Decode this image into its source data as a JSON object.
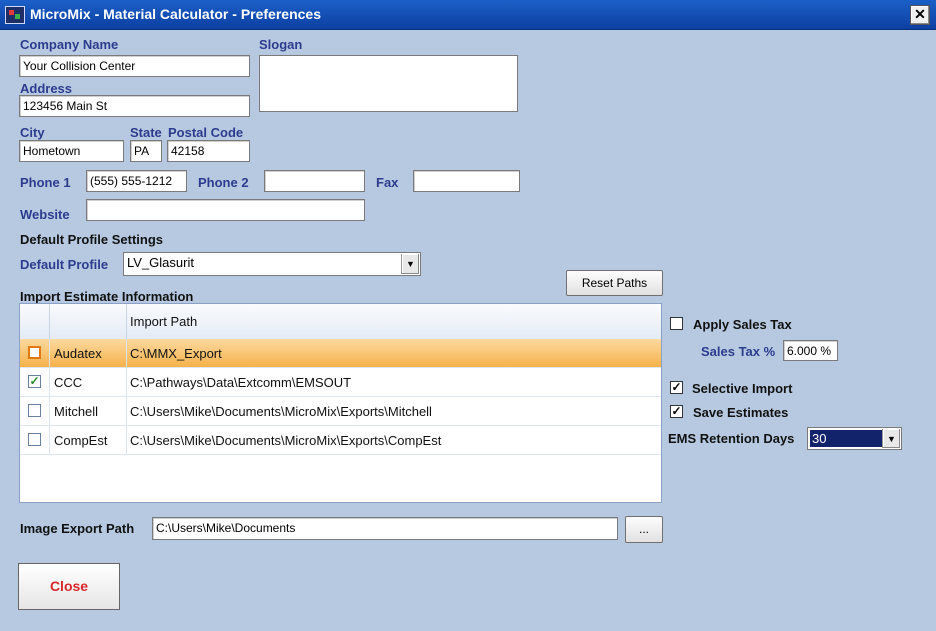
{
  "window": {
    "title": "MicroMix - Material Calculator - Preferences",
    "close_glyph": "✕"
  },
  "company": {
    "name_label": "Company Name",
    "name_value": "Your Collision Center",
    "slogan_label": "Slogan",
    "slogan_value": "",
    "address_label": "Address",
    "address_value": "123456 Main St"
  },
  "location": {
    "city_label": "City",
    "city_value": "Hometown",
    "state_label": "State",
    "state_value": "PA",
    "postal_label": "Postal Code",
    "postal_value": "42158"
  },
  "contact": {
    "phone1_label": "Phone 1",
    "phone1_value": "(555) 555-1212",
    "phone2_label": "Phone 2",
    "phone2_value": "",
    "fax_label": "Fax",
    "fax_value": "",
    "website_label": "Website",
    "website_value": ""
  },
  "profile": {
    "section_label": "Default Profile Settings",
    "default_label": "Default Profile",
    "default_value": "LV_Glasurit"
  },
  "import": {
    "section_label": "Import Estimate Information",
    "reset_label": "Reset Paths",
    "column_path": "Import Path",
    "rows": [
      {
        "name": "Audatex",
        "path": "C:\\MMX_Export",
        "checked": false,
        "check_glyph": ""
      },
      {
        "name": "CCC",
        "path": "C:\\Pathways\\Data\\Extcomm\\EMSOUT",
        "checked": true,
        "check_glyph": "✓"
      },
      {
        "name": "Mitchell",
        "path": "C:\\Users\\Mike\\Documents\\MicroMix\\Exports\\Mitchell",
        "checked": false,
        "check_glyph": ""
      },
      {
        "name": "CompEst",
        "path": "C:\\Users\\Mike\\Documents\\MicroMix\\Exports\\CompEst",
        "checked": false,
        "check_glyph": ""
      }
    ]
  },
  "options": {
    "apply_tax_label": "Apply Sales Tax",
    "apply_tax_checked": false,
    "tax_pct_label": "Sales Tax %",
    "tax_pct_value": "6.000 %",
    "selective_label": "Selective Import",
    "selective_checked": true,
    "selective_glyph": "✓",
    "save_est_label": "Save Estimates",
    "save_est_checked": true,
    "save_est_glyph": "✓",
    "retention_label": "EMS Retention Days",
    "retention_value": "30"
  },
  "export": {
    "label": "Image Export Path",
    "value": "C:\\Users\\Mike\\Documents",
    "browse_label": "..."
  },
  "footer": {
    "close_label": "Close"
  },
  "colors": {
    "label_blue": "#2c3c8e",
    "title_bar": "#1b60c8",
    "background": "#b7c9e0",
    "selected_row": "#f6b24a",
    "close_text": "#d8282c"
  }
}
